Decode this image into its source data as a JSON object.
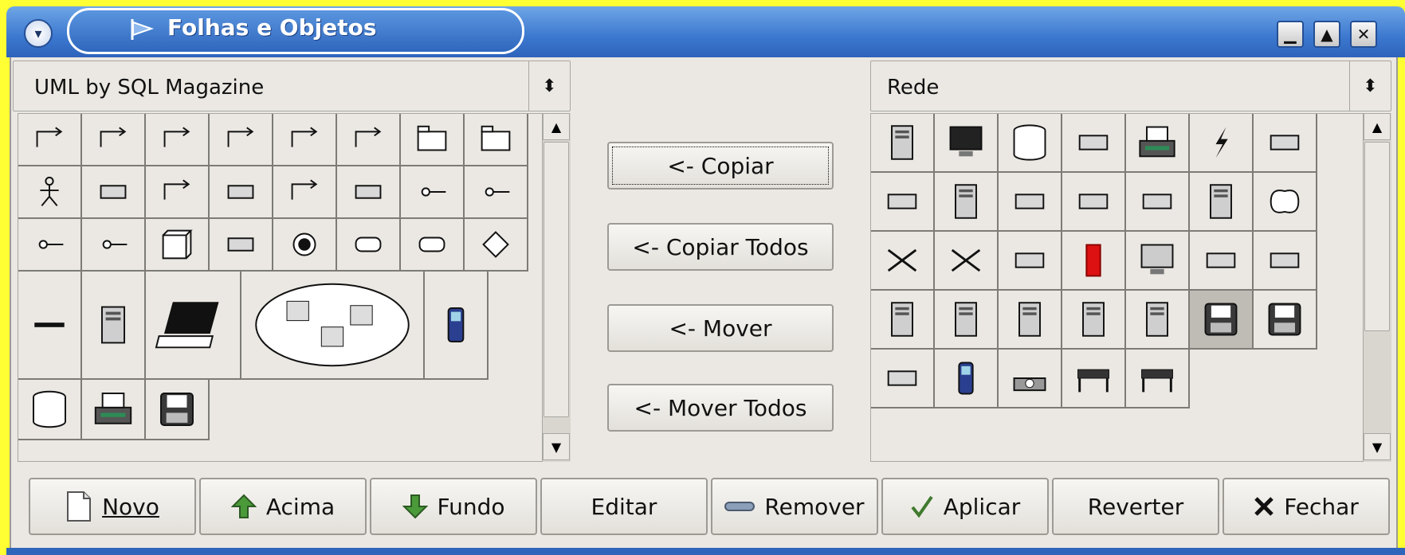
{
  "window": {
    "title": "Folhas e Objetos",
    "controls": {
      "minimize": "▁",
      "maximize": "▲",
      "close": "✕"
    }
  },
  "left_panel": {
    "sheet_select": "UML by SQL Magazine",
    "icons": [
      "uml-dependency-line-icon",
      "uml-implements-line-icon",
      "uml-association-line-icon",
      "uml-message-line-icon",
      "uml-constraint-line-icon",
      "uml-dashed-message-icon",
      "uml-small-package-icon",
      "uml-large-package-icon",
      "uml-actor-icon",
      "uml-use-case-icon",
      "uml-lifeline-icon",
      "uml-object-icon",
      "uml-message-arrow-icon",
      "uml-component-icon",
      "uml-interface-icon",
      "uml-required-interface-icon",
      "uml-provided-port-icon",
      "uml-required-port-icon",
      "uml-node-icon",
      "uml-boundary-icon",
      "uml-final-state-icon",
      "uml-state-icon",
      "uml-activity-icon",
      "uml-branch-icon",
      "uml-fork-bar-icon",
      "server-tower-icon",
      "laptop-icon",
      "network-cloud-icon",
      "mobile-phone-icon",
      "database-cylinder-icon",
      "printer-icon",
      "floppy-disk-icon"
    ]
  },
  "middle_buttons": {
    "copy": "<- Copiar",
    "copy_all": "<- Copiar Todos",
    "move": "<- Mover",
    "move_all": "<- Mover Todos"
  },
  "right_panel": {
    "sheet_select": "Rede",
    "icons": [
      "server-icon",
      "monitor-icon",
      "disk-cylinder-icon",
      "hub-icon",
      "printer-icon",
      "lightning-bolt-icon",
      "wan-link-icon",
      "modem-icon",
      "rack-icon",
      "switch-small-icon",
      "token-ring-icon",
      "router-flat-icon",
      "antenna-tower-icon",
      "cloud-icon",
      "crossover-arrows-icon",
      "x-connector-icon",
      "atm-switch-icon",
      "firewall-icon",
      "crt-monitor-icon",
      "small-hub-icon",
      "network-card-icon",
      "tower-pc-icon",
      "tower-pc2-icon",
      "tower-pc3-icon",
      "tower-pc4-icon",
      "tower-pc5-icon",
      "floppy-dark-icon",
      "floppy-dark2-icon",
      "scanner-icon",
      "mobile-phone-icon",
      "telephone-icon",
      "plotter-icon",
      "desk-plotter-icon"
    ]
  },
  "bottom_buttons": {
    "new": "Novo",
    "up": "Acima",
    "down": "Fundo",
    "edit": "Editar",
    "remove": "Remover",
    "apply": "Aplicar",
    "revert": "Reverter",
    "close": "Fechar"
  }
}
